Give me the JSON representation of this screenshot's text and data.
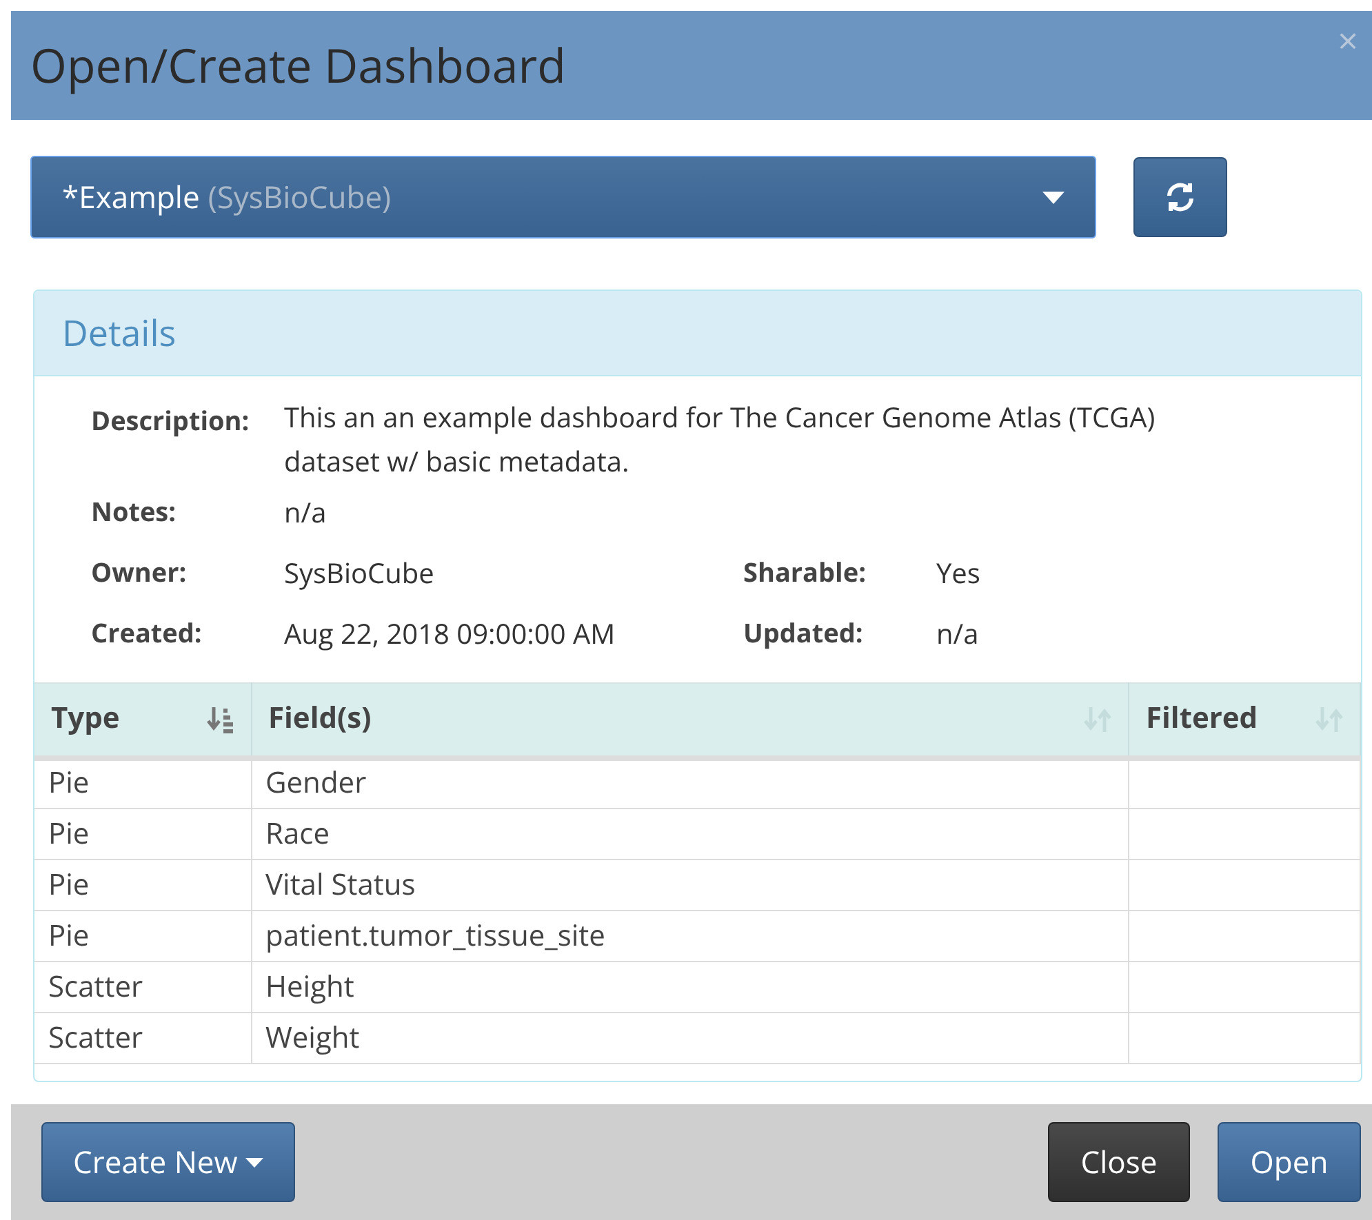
{
  "dialog": {
    "title": "Open/Create Dashboard",
    "close": "×"
  },
  "selector": {
    "name": "*Example",
    "owner": "(SysBioCube)"
  },
  "details": {
    "title": "Details",
    "description": {
      "label": "Description:",
      "value": "This an an example dashboard for The Cancer Genome Atlas (TCGA) dataset w/ basic metadata."
    },
    "notes": {
      "label": "Notes:",
      "value": "n/a"
    },
    "pairs": [
      [
        {
          "label": "Owner:",
          "value": "SysBioCube"
        },
        {
          "label": "Sharable:",
          "value": "Yes"
        }
      ],
      [
        {
          "label": "Created:",
          "value": "Aug 22, 2018 09:00:00 AM"
        },
        {
          "label": "Updated:",
          "value": "n/a"
        }
      ]
    ]
  },
  "table": {
    "columns": [
      {
        "label": "Type",
        "sorted": true
      },
      {
        "label": "Field(s)",
        "sorted": false
      },
      {
        "label": "Filtered",
        "sorted": false
      }
    ],
    "rows": [
      [
        "Pie",
        "Gender",
        ""
      ],
      [
        "Pie",
        "Race",
        ""
      ],
      [
        "Pie",
        "Vital Status",
        ""
      ],
      [
        "Pie",
        "patient.tumor_tissue_site",
        ""
      ],
      [
        "Scatter",
        "Height",
        ""
      ],
      [
        "Scatter",
        "Weight",
        ""
      ]
    ]
  },
  "footer": {
    "create": "Create New",
    "close": "Close",
    "open": "Open"
  }
}
